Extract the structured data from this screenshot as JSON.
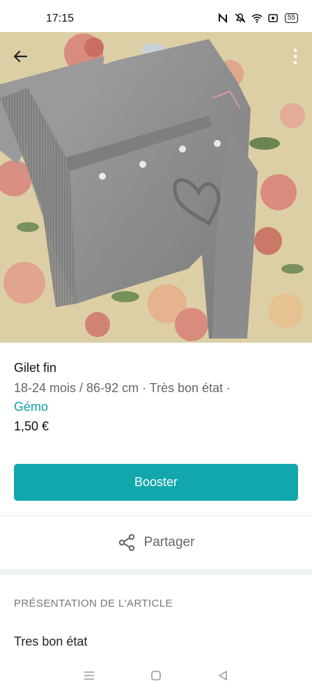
{
  "status_bar": {
    "time": "17:15",
    "battery": "55",
    "icons": [
      "nfc-icon",
      "mute-icon",
      "wifi-icon",
      "screen-record-icon",
      "battery-icon"
    ]
  },
  "header": {
    "back_icon": "back-arrow-icon",
    "menu_icon": "more-vertical-icon"
  },
  "item": {
    "title": "Gilet fin",
    "meta": "18-24 mois / 86-92 cm · Très bon état ·",
    "brand": "Gémo",
    "price": "1,50 €"
  },
  "actions": {
    "boost_label": "Booster",
    "share_label": "Partager",
    "share_icon": "share-icon"
  },
  "presentation": {
    "section_title": "PRÉSENTATION DE L'ARTICLE",
    "description": "Tres bon état"
  },
  "nav": {
    "icons": [
      "menu-icon",
      "home-icon",
      "back-icon"
    ]
  },
  "colors": {
    "accent": "#12a7ad",
    "brand_text": "#0d9ea6"
  }
}
